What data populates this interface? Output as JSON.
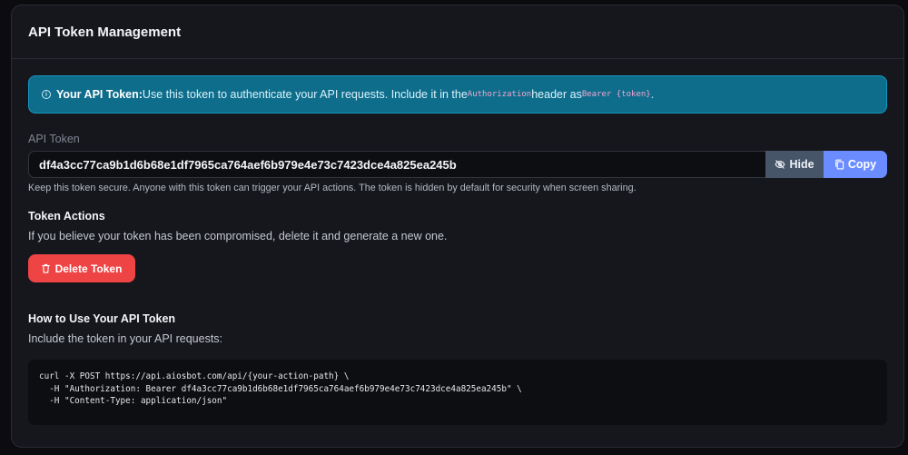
{
  "card": {
    "title": "API Token Management"
  },
  "alert": {
    "icon": "info-icon",
    "lead": "Your API Token:",
    "text_before": "Use this token to authenticate your API requests. Include it in the ",
    "auth_code": "Authorization",
    "text_middle": " header as ",
    "bearer_code": "Bearer {token}",
    "text_end": "."
  },
  "token": {
    "label": "API Token",
    "value": "df4a3cc77ca9b1d6b68e1df7965ca764aef6b979e4e73c7423dce4a825ea245b",
    "hide_label": "Hide",
    "copy_label": "Copy",
    "help": "Keep this token secure. Anyone with this token can trigger your API actions. The token is hidden by default for security when screen sharing."
  },
  "actions": {
    "title": "Token Actions",
    "description": "If you believe your token has been compromised, delete it and generate a new one.",
    "delete_label": "Delete Token"
  },
  "usage": {
    "title": "How to Use Your API Token",
    "description": "Include the token in your API requests:",
    "code_lines": [
      "curl -X POST https://api.aiosbot.com/api/{your-action-path} \\",
      "  -H \"Authorization: Bearer df4a3cc77ca9b1d6b68e1df7965ca764aef6b979e4e73c7423dce4a825ea245b\" \\",
      "  -H \"Content-Type: application/json\""
    ]
  },
  "colors": {
    "alert_bg": "#0f6d8c",
    "copy_button": "#6b8cff",
    "hide_button": "#475569",
    "delete_button": "#ef4444"
  }
}
